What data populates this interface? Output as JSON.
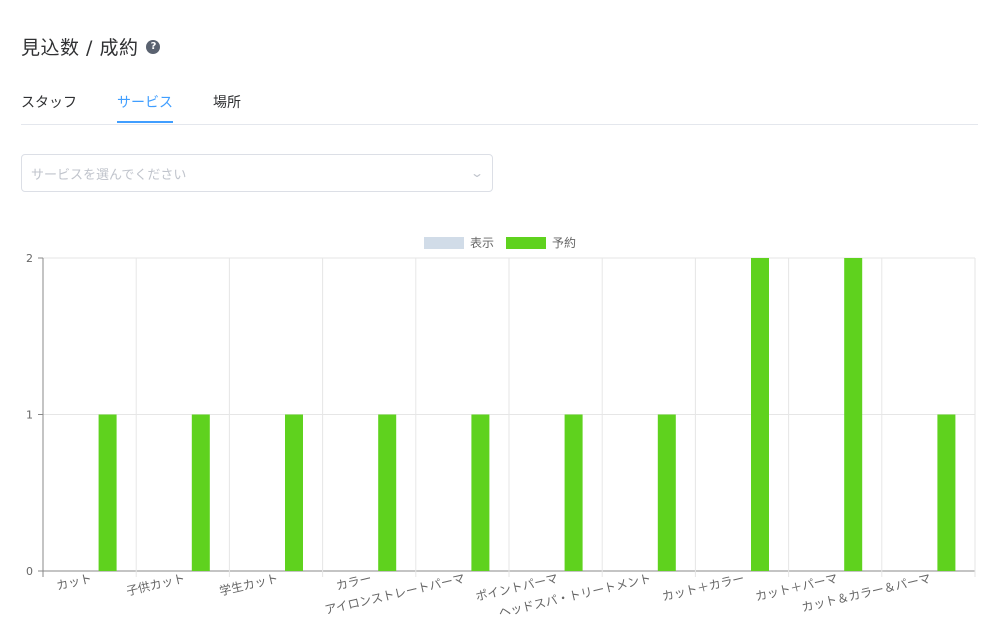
{
  "header": {
    "title": "見込数 / 成約",
    "help_icon": "question-circle-icon"
  },
  "tabs": [
    {
      "label": "スタッフ",
      "active": false
    },
    {
      "label": "サービス",
      "active": true
    },
    {
      "label": "場所",
      "active": false
    }
  ],
  "service_select": {
    "placeholder": "サービスを選んでください",
    "icon": "chevron-down-icon"
  },
  "colors": {
    "accent": "#409eff",
    "series_views": "#d1dce8",
    "series_bookings": "#5fd21e"
  },
  "chart_data": {
    "type": "bar",
    "categories": [
      "カット",
      "子供カット",
      "学生カット",
      "カラー",
      "アイロンストレートパーマ",
      "ポイントパーマ",
      "ヘッドスパ・トリートメント",
      "カット＋カラー",
      "カット＋パーマ",
      "カット＆カラー＆パーマ"
    ],
    "series": [
      {
        "name": "表示",
        "values": [
          0,
          0,
          0,
          0,
          0,
          0,
          0,
          0,
          0,
          0
        ]
      },
      {
        "name": "予約",
        "values": [
          1,
          1,
          1,
          1,
          1,
          1,
          1,
          2,
          2,
          1
        ]
      }
    ],
    "yticks": [
      "0",
      "1",
      "2"
    ],
    "ylim": [
      0,
      2
    ],
    "grid": true,
    "legend_position": "top-center"
  }
}
